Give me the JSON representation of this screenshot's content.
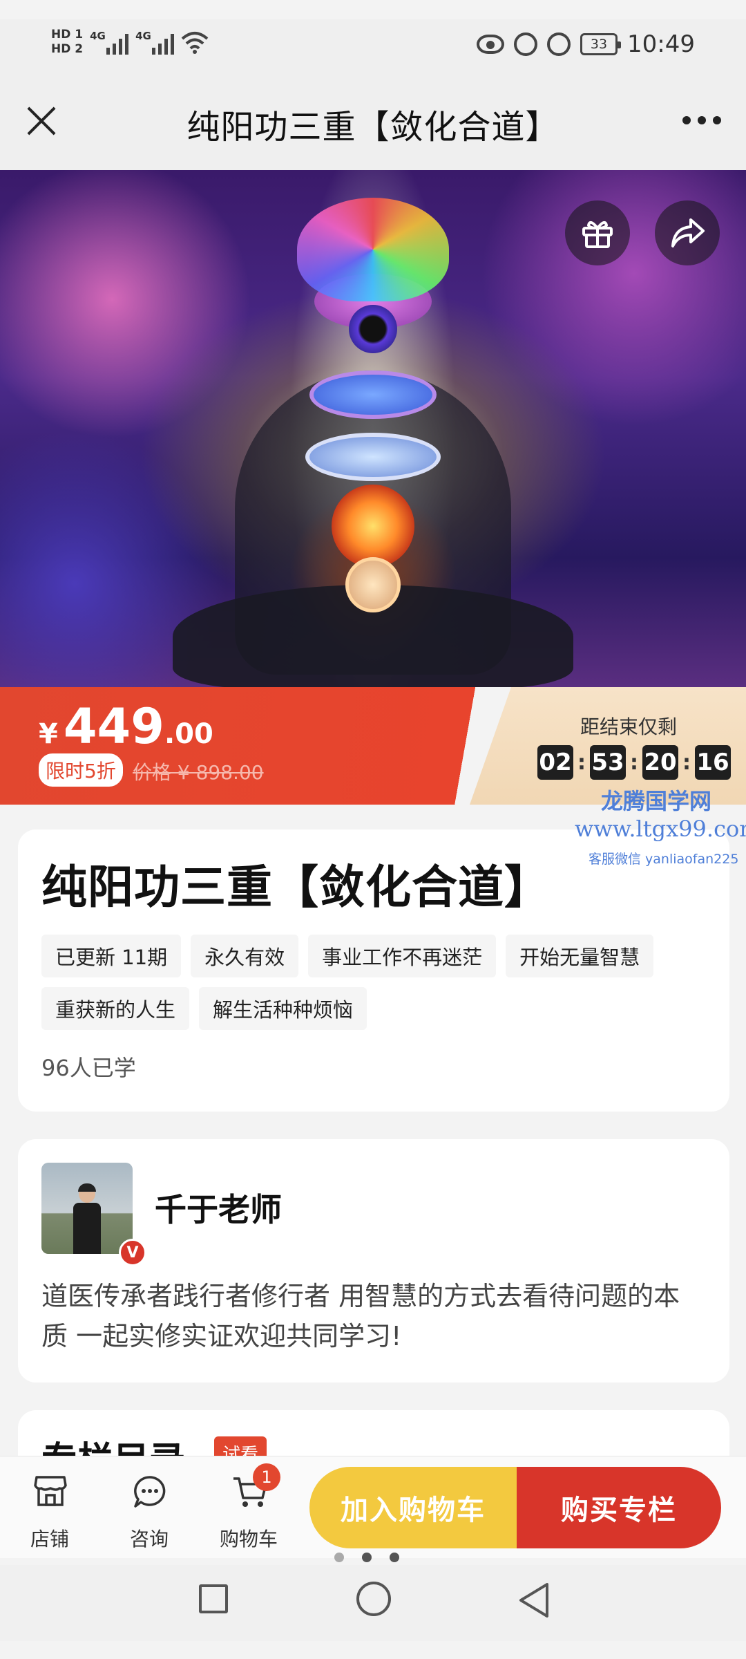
{
  "status_bar": {
    "hd1": "HD 1",
    "hd2": "HD 2",
    "net1": "4G",
    "net2": "4G",
    "battery": "33",
    "time": "10:49"
  },
  "nav": {
    "title": "纯阳功三重【敛化合道】",
    "close_icon": "close-icon",
    "more_icon": "more-icon"
  },
  "price": {
    "currency": "¥",
    "integer": "449",
    "decimal": ".00",
    "discount_label": "限时5折",
    "original_price": "价格 ¥ 898.00"
  },
  "countdown": {
    "label": "距结束仅剩",
    "hours": "02",
    "minutes": "53",
    "seconds": "20",
    "centis": "16"
  },
  "watermark": {
    "line1": "龙腾国学网",
    "line2": "www.ltgx99.com",
    "line3": "客服微信 yanliaofan225"
  },
  "course": {
    "title": "纯阳功三重【敛化合道】",
    "tags": [
      "已更新 11期",
      "永久有效",
      "事业工作不再迷茫",
      "开始无量智慧",
      "重获新的人生",
      "解生活种种烦恼"
    ],
    "learners": "96人已学"
  },
  "teacher": {
    "name": "千于老师",
    "verified_badge": "V",
    "description": "道医传承者践行者修行者 用智慧的方式去看待问题的本质 一起实修实证欢迎共同学习!"
  },
  "catalog": {
    "title": "专栏目录",
    "trial_badge": "试看"
  },
  "action_bar": {
    "shop_label": "店铺",
    "chat_label": "咨询",
    "cart_label": "购物车",
    "cart_count": "1",
    "add_to_cart": "加入购物车",
    "buy": "购买专栏"
  },
  "colors": {
    "accent_red": "#e2472f",
    "cart_yellow": "#f3c93f",
    "buy_red": "#d8352a"
  }
}
